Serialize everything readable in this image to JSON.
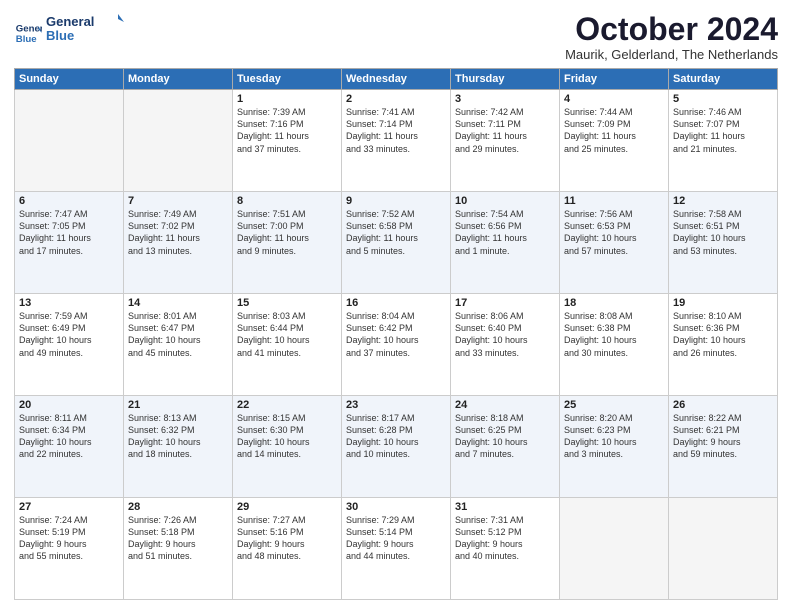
{
  "logo": {
    "line1": "General",
    "line2": "Blue"
  },
  "title": "October 2024",
  "location": "Maurik, Gelderland, The Netherlands",
  "headers": [
    "Sunday",
    "Monday",
    "Tuesday",
    "Wednesday",
    "Thursday",
    "Friday",
    "Saturday"
  ],
  "weeks": [
    [
      {
        "day": "",
        "info": ""
      },
      {
        "day": "",
        "info": ""
      },
      {
        "day": "1",
        "info": "Sunrise: 7:39 AM\nSunset: 7:16 PM\nDaylight: 11 hours\nand 37 minutes."
      },
      {
        "day": "2",
        "info": "Sunrise: 7:41 AM\nSunset: 7:14 PM\nDaylight: 11 hours\nand 33 minutes."
      },
      {
        "day": "3",
        "info": "Sunrise: 7:42 AM\nSunset: 7:11 PM\nDaylight: 11 hours\nand 29 minutes."
      },
      {
        "day": "4",
        "info": "Sunrise: 7:44 AM\nSunset: 7:09 PM\nDaylight: 11 hours\nand 25 minutes."
      },
      {
        "day": "5",
        "info": "Sunrise: 7:46 AM\nSunset: 7:07 PM\nDaylight: 11 hours\nand 21 minutes."
      }
    ],
    [
      {
        "day": "6",
        "info": "Sunrise: 7:47 AM\nSunset: 7:05 PM\nDaylight: 11 hours\nand 17 minutes."
      },
      {
        "day": "7",
        "info": "Sunrise: 7:49 AM\nSunset: 7:02 PM\nDaylight: 11 hours\nand 13 minutes."
      },
      {
        "day": "8",
        "info": "Sunrise: 7:51 AM\nSunset: 7:00 PM\nDaylight: 11 hours\nand 9 minutes."
      },
      {
        "day": "9",
        "info": "Sunrise: 7:52 AM\nSunset: 6:58 PM\nDaylight: 11 hours\nand 5 minutes."
      },
      {
        "day": "10",
        "info": "Sunrise: 7:54 AM\nSunset: 6:56 PM\nDaylight: 11 hours\nand 1 minute."
      },
      {
        "day": "11",
        "info": "Sunrise: 7:56 AM\nSunset: 6:53 PM\nDaylight: 10 hours\nand 57 minutes."
      },
      {
        "day": "12",
        "info": "Sunrise: 7:58 AM\nSunset: 6:51 PM\nDaylight: 10 hours\nand 53 minutes."
      }
    ],
    [
      {
        "day": "13",
        "info": "Sunrise: 7:59 AM\nSunset: 6:49 PM\nDaylight: 10 hours\nand 49 minutes."
      },
      {
        "day": "14",
        "info": "Sunrise: 8:01 AM\nSunset: 6:47 PM\nDaylight: 10 hours\nand 45 minutes."
      },
      {
        "day": "15",
        "info": "Sunrise: 8:03 AM\nSunset: 6:44 PM\nDaylight: 10 hours\nand 41 minutes."
      },
      {
        "day": "16",
        "info": "Sunrise: 8:04 AM\nSunset: 6:42 PM\nDaylight: 10 hours\nand 37 minutes."
      },
      {
        "day": "17",
        "info": "Sunrise: 8:06 AM\nSunset: 6:40 PM\nDaylight: 10 hours\nand 33 minutes."
      },
      {
        "day": "18",
        "info": "Sunrise: 8:08 AM\nSunset: 6:38 PM\nDaylight: 10 hours\nand 30 minutes."
      },
      {
        "day": "19",
        "info": "Sunrise: 8:10 AM\nSunset: 6:36 PM\nDaylight: 10 hours\nand 26 minutes."
      }
    ],
    [
      {
        "day": "20",
        "info": "Sunrise: 8:11 AM\nSunset: 6:34 PM\nDaylight: 10 hours\nand 22 minutes."
      },
      {
        "day": "21",
        "info": "Sunrise: 8:13 AM\nSunset: 6:32 PM\nDaylight: 10 hours\nand 18 minutes."
      },
      {
        "day": "22",
        "info": "Sunrise: 8:15 AM\nSunset: 6:30 PM\nDaylight: 10 hours\nand 14 minutes."
      },
      {
        "day": "23",
        "info": "Sunrise: 8:17 AM\nSunset: 6:28 PM\nDaylight: 10 hours\nand 10 minutes."
      },
      {
        "day": "24",
        "info": "Sunrise: 8:18 AM\nSunset: 6:25 PM\nDaylight: 10 hours\nand 7 minutes."
      },
      {
        "day": "25",
        "info": "Sunrise: 8:20 AM\nSunset: 6:23 PM\nDaylight: 10 hours\nand 3 minutes."
      },
      {
        "day": "26",
        "info": "Sunrise: 8:22 AM\nSunset: 6:21 PM\nDaylight: 9 hours\nand 59 minutes."
      }
    ],
    [
      {
        "day": "27",
        "info": "Sunrise: 7:24 AM\nSunset: 5:19 PM\nDaylight: 9 hours\nand 55 minutes."
      },
      {
        "day": "28",
        "info": "Sunrise: 7:26 AM\nSunset: 5:18 PM\nDaylight: 9 hours\nand 51 minutes."
      },
      {
        "day": "29",
        "info": "Sunrise: 7:27 AM\nSunset: 5:16 PM\nDaylight: 9 hours\nand 48 minutes."
      },
      {
        "day": "30",
        "info": "Sunrise: 7:29 AM\nSunset: 5:14 PM\nDaylight: 9 hours\nand 44 minutes."
      },
      {
        "day": "31",
        "info": "Sunrise: 7:31 AM\nSunset: 5:12 PM\nDaylight: 9 hours\nand 40 minutes."
      },
      {
        "day": "",
        "info": ""
      },
      {
        "day": "",
        "info": ""
      }
    ]
  ]
}
